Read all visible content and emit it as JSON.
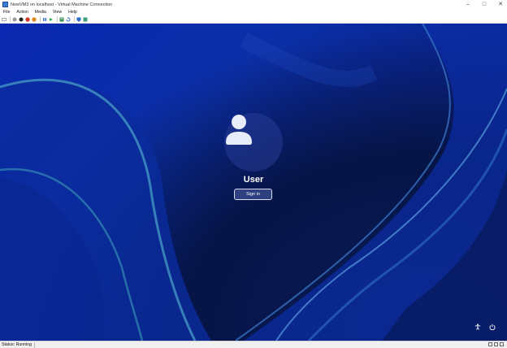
{
  "window": {
    "title": "NewVM3 on localhost - Virtual Machine Connection",
    "controls": {
      "minimize": "–",
      "maximize": "□",
      "close": "✕"
    }
  },
  "menu": {
    "items": [
      "File",
      "Action",
      "Media",
      "View",
      "Help"
    ]
  },
  "toolbar": {
    "icons": [
      "ctrl-alt-del-icon",
      "start-icon",
      "turn-off-icon",
      "shutdown-icon",
      "save-icon",
      "pause-icon",
      "resume-icon",
      "checkpoint-icon",
      "revert-icon",
      "enhanced-session-icon",
      "share-icon"
    ],
    "colors": {
      "stop": "#d03a2a",
      "save": "#e08a1e",
      "play": "#2ea84a",
      "pause": "#2b6cd9"
    }
  },
  "login": {
    "username": "User",
    "sign_in_label": "Sign in",
    "icons": [
      "user-avatar-icon",
      "accessibility-icon",
      "power-icon"
    ]
  },
  "status": {
    "text": "Status: Running"
  },
  "colors": {
    "wallpaper_primary": "#0b2fa8",
    "wallpaper_dark": "#061446"
  }
}
